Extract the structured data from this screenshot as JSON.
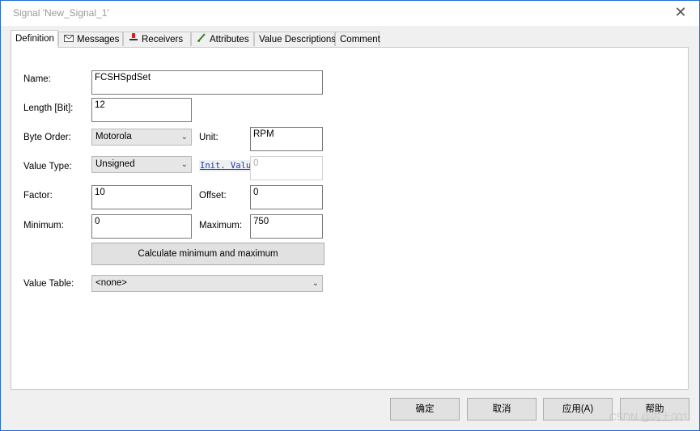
{
  "window": {
    "title": "Signal 'New_Signal_1'",
    "close_glyph": "✕"
  },
  "tabs": [
    {
      "label": "Definition",
      "icon": ""
    },
    {
      "label": "Messages",
      "icon": "envelope-icon"
    },
    {
      "label": "Receivers",
      "icon": "receiver-icon"
    },
    {
      "label": "Attributes",
      "icon": "pencil-icon"
    },
    {
      "label": "Value Descriptions",
      "icon": ""
    },
    {
      "label": "Comment",
      "icon": ""
    }
  ],
  "form": {
    "name_label": "Name:",
    "name_value": "FCSHSpdSet",
    "length_label": "Length [Bit]:",
    "length_value": "12",
    "byte_order_label": "Byte Order:",
    "byte_order_value": "Motorola",
    "unit_label": "Unit:",
    "unit_value": "RPM",
    "value_type_label": "Value Type:",
    "value_type_value": "Unsigned",
    "init_value_label": "Init. Value",
    "init_value_value": "0",
    "factor_label": "Factor:",
    "factor_value": "10",
    "offset_label": "Offset:",
    "offset_value": "0",
    "minimum_label": "Minimum:",
    "minimum_value": "0",
    "maximum_label": "Maximum:",
    "maximum_value": "750",
    "calc_button": "Calculate minimum and maximum",
    "value_table_label": "Value Table:",
    "value_table_value": "<none>"
  },
  "footer": {
    "ok": "确定",
    "cancel": "取消",
    "apply": "应用(A)",
    "help": "帮助"
  },
  "watermark": "CSDN @内土001"
}
